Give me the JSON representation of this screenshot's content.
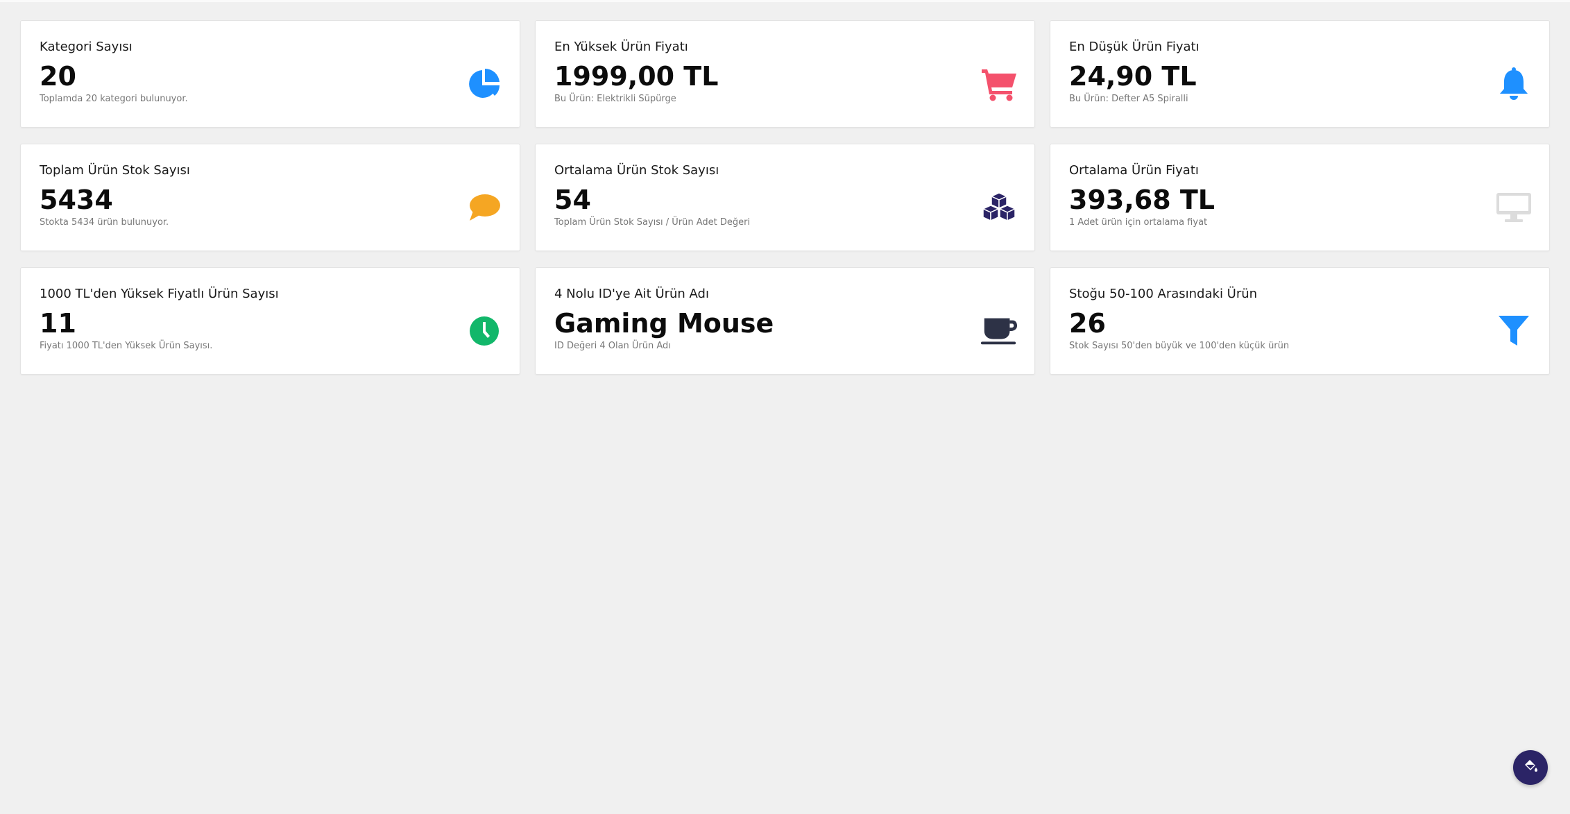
{
  "cards": [
    {
      "title": "Kategori Sayısı",
      "value": "20",
      "sub": "Toplamda 20 kategori bulunuyor.",
      "icon": "pie-chart-icon",
      "color": "#1e90ff"
    },
    {
      "title": "En Yüksek Ürün Fiyatı",
      "value": "1999,00 TL",
      "sub": "Bu Ürün: Elektrikli Süpürge",
      "icon": "shopping-cart-icon",
      "color": "#f4516c"
    },
    {
      "title": "En Düşük Ürün Fiyatı",
      "value": "24,90 TL",
      "sub": "Bu Ürün: Defter A5 Spiralli",
      "icon": "bell-icon",
      "color": "#1e90ff"
    },
    {
      "title": "Toplam Ürün Stok Sayısı",
      "value": "5434",
      "sub": "Stokta 5434 ürün bulunuyor.",
      "icon": "comment-icon",
      "color": "#f5a623"
    },
    {
      "title": "Ortalama Ürün Stok Sayısı",
      "value": "54",
      "sub": "Toplam Ürün Stok Sayısı / Ürün Adet Değeri",
      "icon": "cubes-icon",
      "color": "#2b2466"
    },
    {
      "title": "Ortalama Ürün Fiyatı",
      "value": "393,68 TL",
      "sub": "1 Adet ürün için ortalama fiyat",
      "icon": "desktop-icon",
      "color": "#dcdcdc"
    },
    {
      "title": "1000 TL'den Yüksek Fiyatlı Ürün Sayısı",
      "value": "11",
      "sub": "Fiyatı 1000 TL'den Yüksek Ürün Sayısı.",
      "icon": "clock-icon",
      "color": "#12b76a"
    },
    {
      "title": "4 Nolu ID'ye Ait Ürün Adı",
      "value": "Gaming Mouse",
      "sub": "ID Değeri 4 Olan Ürün Adı",
      "icon": "coffee-icon",
      "color": "#2d3246"
    },
    {
      "title": "Stoğu 50-100 Arasındaki Ürün",
      "value": "26",
      "sub": "Stok Sayısı 50'den büyük ve 100'den küçük ürün",
      "icon": "filter-icon",
      "color": "#1e90ff"
    }
  ],
  "fab": {
    "icon": "paint-bucket-icon",
    "color": "#2b2466"
  }
}
